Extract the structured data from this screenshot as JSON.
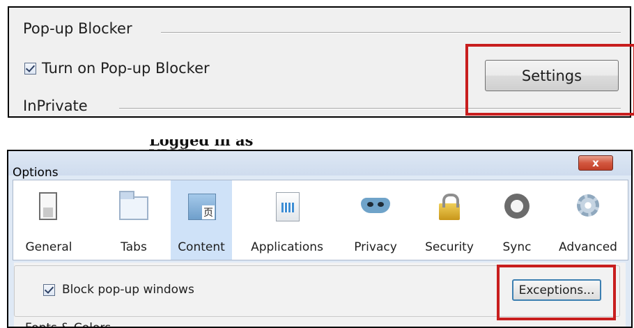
{
  "ie": {
    "popup_group_title": "Pop-up Blocker",
    "turn_on_label": "Turn on Pop-up Blocker",
    "turn_on_checked": true,
    "settings_button": "Settings",
    "inprivate_group_title": "InPrivate"
  },
  "between_text": "Logged in as VISITOR",
  "firefox": {
    "window_title": "Options",
    "close_glyph": "x",
    "tabs": [
      {
        "label": "General",
        "icon": "switch-icon"
      },
      {
        "label": "Tabs",
        "icon": "tabs-window-icon"
      },
      {
        "label": "Content",
        "icon": "content-page-icon",
        "selected": true
      },
      {
        "label": "Applications",
        "icon": "applications-icon"
      },
      {
        "label": "Privacy",
        "icon": "privacy-mask-icon"
      },
      {
        "label": "Security",
        "icon": "padlock-icon"
      },
      {
        "label": "Sync",
        "icon": "sync-icon"
      },
      {
        "label": "Advanced",
        "icon": "gear-icon"
      }
    ],
    "block_popups_label": "Block pop-up windows",
    "block_popups_checked": true,
    "exceptions_button": "Exceptions...",
    "next_section_label": "Fonts & Colors"
  },
  "colors": {
    "highlight": "#c81e1e",
    "selected_tab": "#cfe2f8",
    "window_frame": "#dfe9f5"
  }
}
